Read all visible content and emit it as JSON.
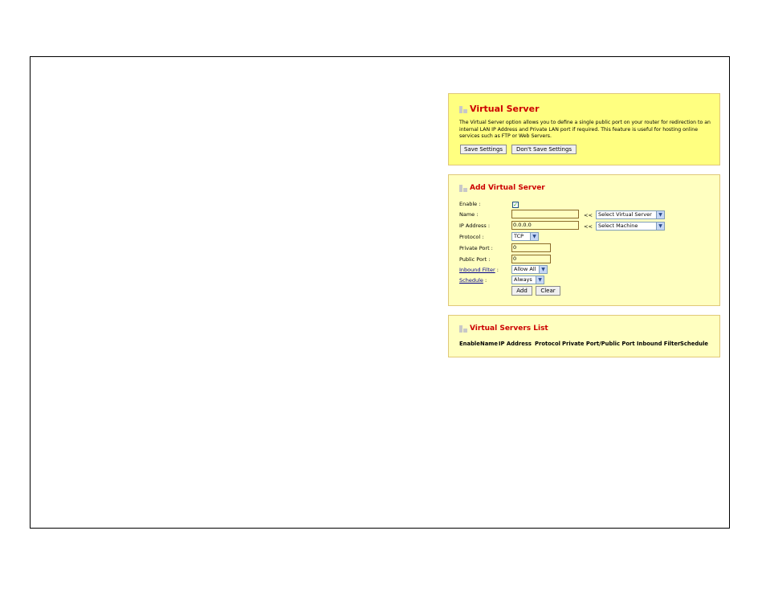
{
  "virtual_server": {
    "title": "Virtual Server",
    "description": "The Virtual Server option allows you to define a single public port on your router for redirection to an internal LAN IP Address and Private LAN port if required. This feature is useful for hosting online services such as FTP or Web Servers.",
    "save_label": "Save Settings",
    "dont_save_label": "Don't Save Settings"
  },
  "add_virtual_server": {
    "title": "Add Virtual Server",
    "enable_label": "Enable :",
    "enable_checked": true,
    "name_label": "Name :",
    "name_value": "",
    "ip_label": "IP Address :",
    "ip_value": "0.0.0.0",
    "arrow_text": "<<",
    "select_virtual_server": "Select Virtual Server",
    "select_machine": "Select Machine",
    "protocol_label": "Protocol :",
    "protocol_value": "TCP",
    "private_port_label": "Private Port :",
    "private_port_value": "0",
    "public_port_label": "Public Port :",
    "public_port_value": "0",
    "inbound_filter_label": "Inbound Filter",
    "inbound_filter_value": "Allow All",
    "schedule_label": "Schedule",
    "schedule_value": "Always",
    "colon": ":",
    "add_label": "Add",
    "clear_label": "Clear"
  },
  "virtual_servers_list": {
    "title": "Virtual Servers List",
    "columns": [
      "Enable",
      "Name",
      "IP Address",
      "Protocol",
      "Private Port/Public Port",
      "Inbound Filter",
      "Schedule"
    ]
  },
  "colors": {
    "heading": "#cc0000",
    "panel_top": "#ffff80",
    "panel": "#ffffc0",
    "link": "#00008b"
  }
}
